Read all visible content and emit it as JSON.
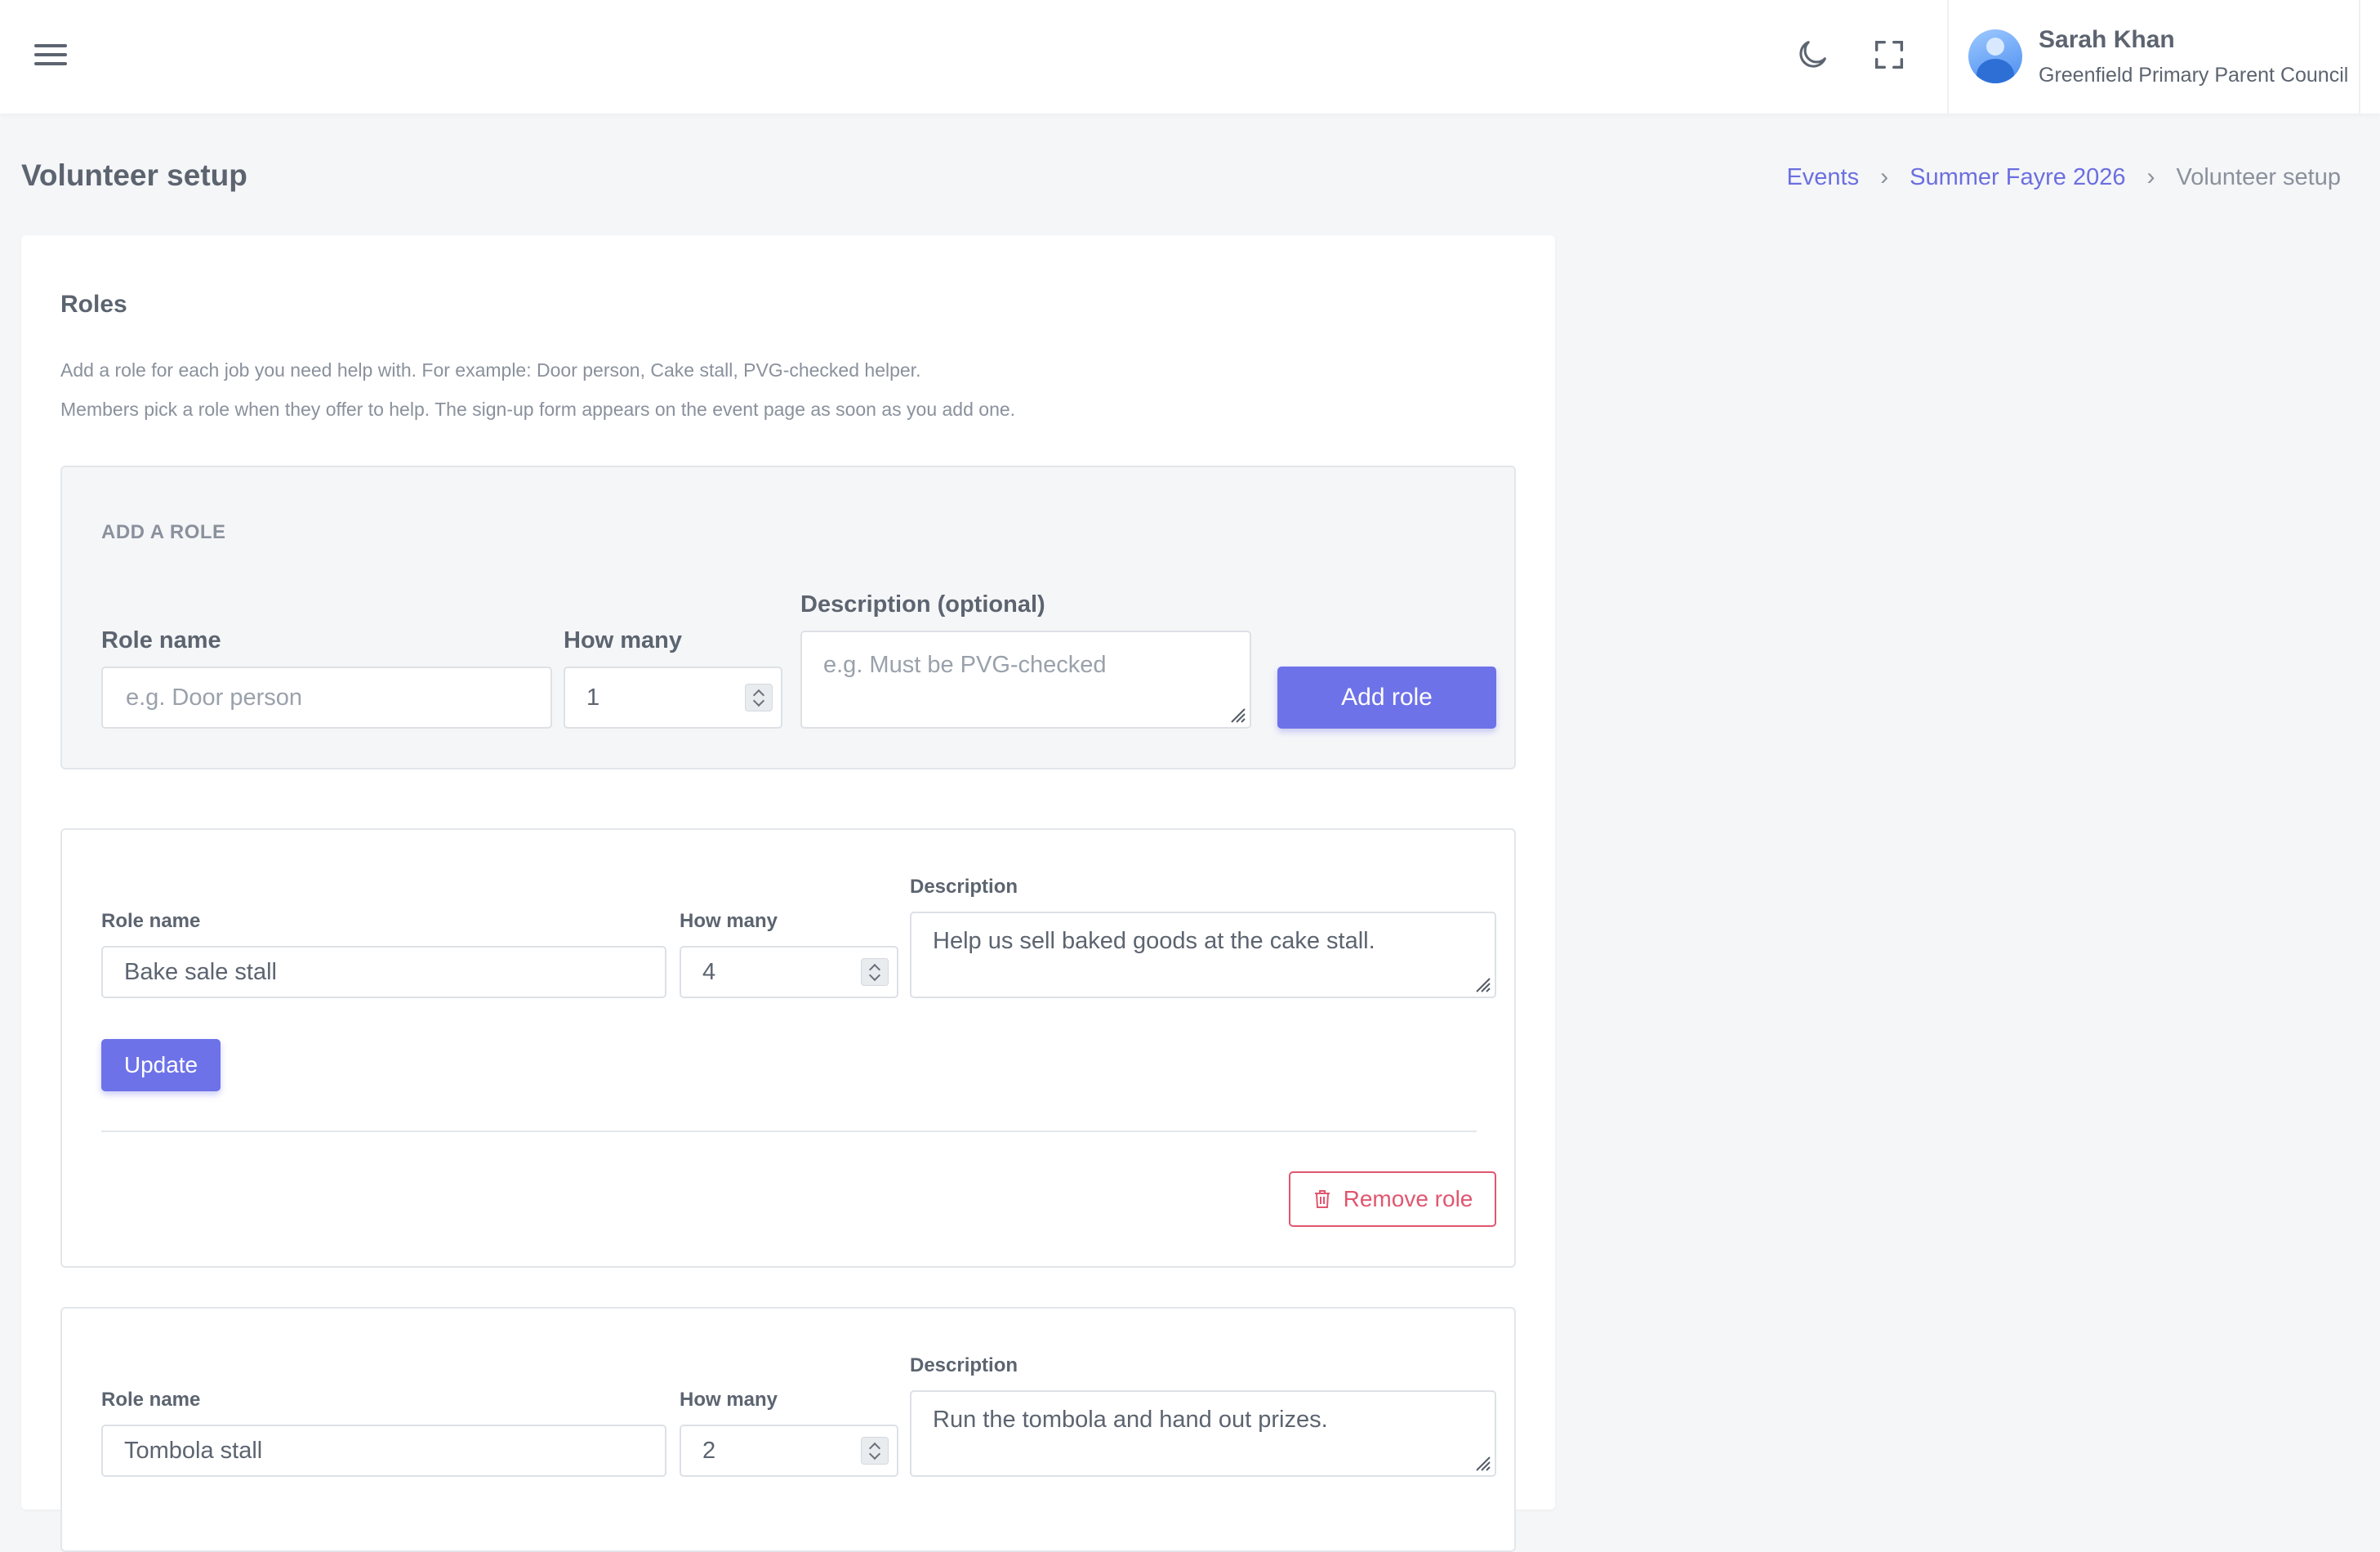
{
  "header": {
    "user_name": "Sarah Khan",
    "user_org": "Greenfield Primary Parent Council"
  },
  "page": {
    "title": "Volunteer setup",
    "breadcrumb": [
      "Events",
      "Summer Fayre 2026",
      "Volunteer setup"
    ]
  },
  "roles_section": {
    "title": "Roles",
    "help_line_1": "Add a role for each job you need help with. For example: Door person, Cake stall, PVG-checked helper.",
    "help_line_2": "Members pick a role when they offer to help. The sign-up form appears on the event page as soon as you add one."
  },
  "add_role": {
    "heading": "ADD A ROLE",
    "role_name_label": "Role name",
    "role_name_placeholder": "e.g. Door person",
    "how_many_label": "How many",
    "how_many_value": "1",
    "description_label": "Description (optional)",
    "description_placeholder": "e.g. Must be PVG-checked",
    "submit_label": "Add role"
  },
  "roles": [
    {
      "role_name_label": "Role name",
      "role_name": "Bake sale stall",
      "how_many_label": "How many",
      "how_many": "4",
      "description_label": "Description",
      "description": "Help us sell baked goods at the cake stall.",
      "update_label": "Update",
      "remove_label": "Remove role"
    },
    {
      "role_name_label": "Role name",
      "role_name": "Tombola stall",
      "how_many_label": "How many",
      "how_many": "2",
      "description_label": "Description",
      "description": "Run the tombola and hand out prizes."
    }
  ],
  "icons": {
    "menu": "hamburger-menu-icon",
    "theme": "moon-icon",
    "fullscreen": "fullscreen-icon",
    "remove": "trash-icon"
  },
  "colors": {
    "primary": "#6e72e8",
    "danger": "#e0566f",
    "link": "#6b6fe0"
  }
}
